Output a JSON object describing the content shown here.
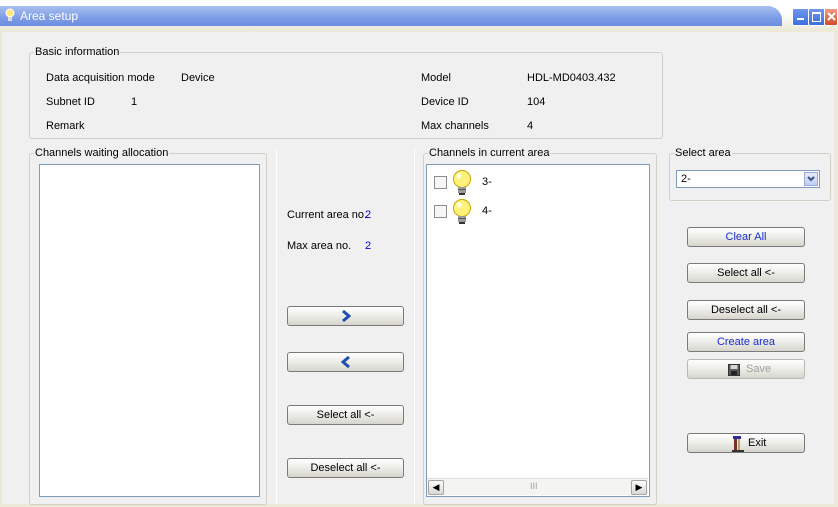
{
  "window": {
    "title": "Area setup"
  },
  "basic_info": {
    "legend": "Basic information",
    "daq_label": "Data acquisition mode",
    "daq_value": "Device",
    "subnet_label": "Subnet ID",
    "subnet_value": "1",
    "remark_label": "Remark",
    "model_label": "Model",
    "model_value": "HDL-MD0403.432",
    "device_label": "Device ID",
    "device_value": "104",
    "maxch_label": "Max channels",
    "maxch_value": "4"
  },
  "waiting": {
    "legend": "Channels waiting allocation"
  },
  "middle": {
    "current_label": "Current area no.",
    "current_value": "2",
    "max_label": "Max area no.",
    "max_value": "2",
    "select_all": "Select all <-",
    "deselect_all": "Deselect all <-"
  },
  "current_area": {
    "legend": "Channels in current area",
    "items": [
      {
        "label": "3-",
        "icon": "lightbulb-icon",
        "checked": false
      },
      {
        "label": "4-",
        "icon": "lightbulb-icon",
        "checked": false
      }
    ],
    "scroll_mid": "III"
  },
  "select_area": {
    "legend": "Select area",
    "value": "2-"
  },
  "actions": {
    "clear_all": "Clear All",
    "select_all": "Select all <-",
    "deselect_all": "Deselect all <-",
    "create_area": "Create area",
    "save": "Save",
    "exit": "Exit"
  },
  "colors": {
    "accent_blue": "#0000cc",
    "title_blue": "#7c9ce6"
  }
}
